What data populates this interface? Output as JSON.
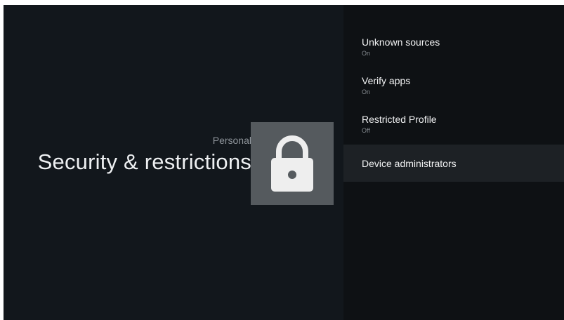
{
  "left_panel": {
    "section": "Personal",
    "title": "Security & restrictions",
    "icon": "lock-icon"
  },
  "menu": {
    "items": [
      {
        "title": "Unknown sources",
        "subtitle": "On"
      },
      {
        "title": "Verify apps",
        "subtitle": "On"
      },
      {
        "title": "Restricted Profile",
        "subtitle": "Off"
      },
      {
        "title": "Device administrators",
        "subtitle": ""
      }
    ],
    "selected": "Device administrators"
  },
  "colors": {
    "background": "#11161b",
    "right_panel": "#0e1114",
    "selected_row": "#1d2125",
    "icon_tile": "#555a5e"
  }
}
